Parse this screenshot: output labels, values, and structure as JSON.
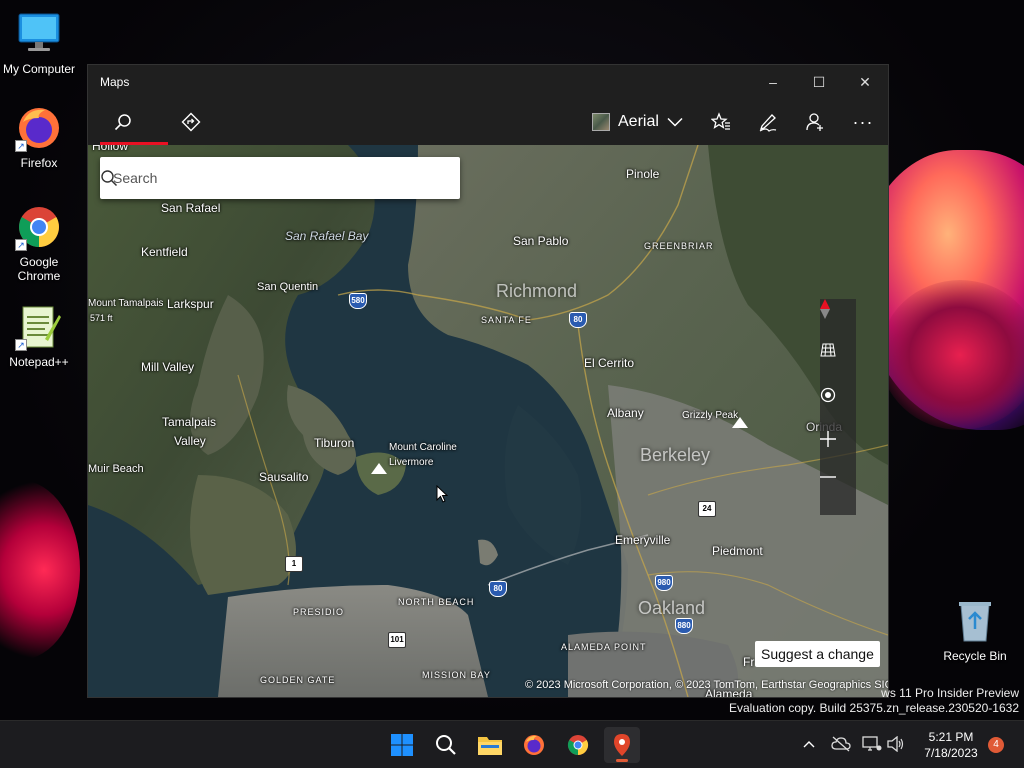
{
  "desktop": {
    "icons": [
      {
        "label": "My Computer"
      },
      {
        "label": "Firefox"
      },
      {
        "label": "Google Chrome"
      },
      {
        "label": "Notepad++"
      },
      {
        "label": "Recycle Bin"
      }
    ],
    "watermark": {
      "line1": "ws 11 Pro Insider Preview",
      "line2": "Evaluation copy. Build 25375.zn_release.230520-1632"
    }
  },
  "window": {
    "title": "Maps",
    "controls": {
      "minimize": "–",
      "maximize": "☐",
      "close": "✕"
    },
    "toolbar": {
      "search_icon": "search-icon",
      "directions_icon": "directions-icon",
      "view_mode": "Aerial",
      "favorites_icon": "favorites-icon",
      "ink_icon": "ink-pen-icon",
      "account_icon": "account-icon",
      "more_label": "···"
    }
  },
  "map": {
    "search": {
      "placeholder": "Search"
    },
    "labels": {
      "hollow": "Hollow",
      "san_rafael": "San Rafael",
      "san_rafael_bay": "San Rafael Bay",
      "san_pablo": "San Pablo",
      "pinole": "Pinole",
      "greenbriar": "GREENBRIAR",
      "kentfield": "Kentfield",
      "larkspur": "Larkspur",
      "san_quentin": "San Quentin",
      "mount_tamalpais": "Mount Tamalpais",
      "mount_tamalpais_ft": "571 ft",
      "richmond": "Richmond",
      "santa_fe": "SANTA FE",
      "el_cerrito": "El Cerrito",
      "mill_valley": "Mill Valley",
      "albany": "Albany",
      "grizzly_peak": "Grizzly Peak",
      "orinda": "Orinda",
      "tamalpais_valley_1": "Tamalpais",
      "tamalpais_valley_2": "Valley",
      "tiburon": "Tiburon",
      "mount_caroline_1": "Mount Caroline",
      "mount_caroline_2": "Livermore",
      "berkeley": "Berkeley",
      "muir_beach": "Muir Beach",
      "sausalito": "Sausalito",
      "emeryville": "Emeryville",
      "piedmont": "Piedmont",
      "presidio": "PRESIDIO",
      "north_beach": "NORTH BEACH",
      "oakland": "Oakland",
      "alameda_point": "ALAMEDA POINT",
      "golden_gate": "GOLDEN GATE",
      "mission_bay": "MISSION BAY",
      "alameda": "Alameda",
      "fr": "Fr"
    },
    "shields": {
      "i580": "580",
      "i80a": "80",
      "i80b": "80",
      "i980": "980",
      "i880": "880",
      "r24": "24",
      "r1": "1",
      "r101": "101"
    },
    "suggest_label": "Suggest a change",
    "copyright": "© 2023 Microsoft Corporation, © 2023 TomTom, Earthstar Geographics  SIO"
  },
  "taskbar": {
    "time": "5:21 PM",
    "date": "7/18/2023",
    "notifications": "4"
  }
}
